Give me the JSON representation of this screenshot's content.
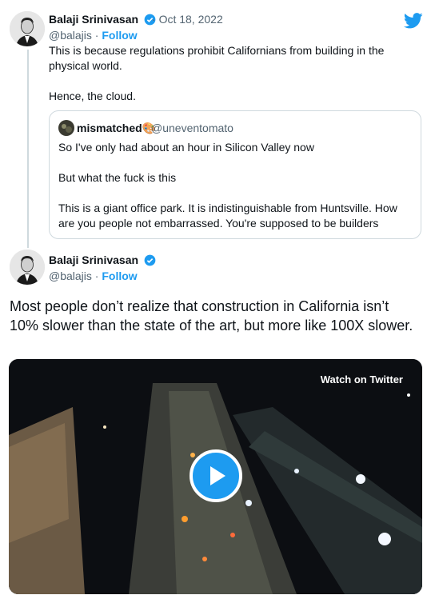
{
  "tweet1": {
    "author": "Balaji Srinivasan",
    "date": "Oct 18, 2022",
    "handle": "@balajis",
    "follow_label": "Follow",
    "line1": "This is because regulations prohibit Californians from building in the",
    "line2": "physical world.",
    "line3": "Hence, the cloud."
  },
  "quote": {
    "author": "mismatched🎨",
    "handle": "@uneventomato",
    "p1": "So I've only had about an hour in Silicon Valley now",
    "p2": "But what the fuck is this",
    "p3a": "This is a giant office park. It is indistinguishable from Huntsville. How",
    "p3b": "are you people not embarrassed. You're supposed to be builders"
  },
  "tweet2": {
    "author": "Balaji Srinivasan",
    "handle": "@balajis",
    "follow_label": "Follow",
    "body": "Most people don’t realize that construction in California isn’t 10% slower than the state of the art, but more like 100X slower."
  },
  "video": {
    "watch_label": "Watch on Twitter"
  },
  "colors": {
    "accent": "#1d9bf0",
    "text": "#0f1419",
    "muted": "#536471",
    "border": "#cfd9de"
  }
}
